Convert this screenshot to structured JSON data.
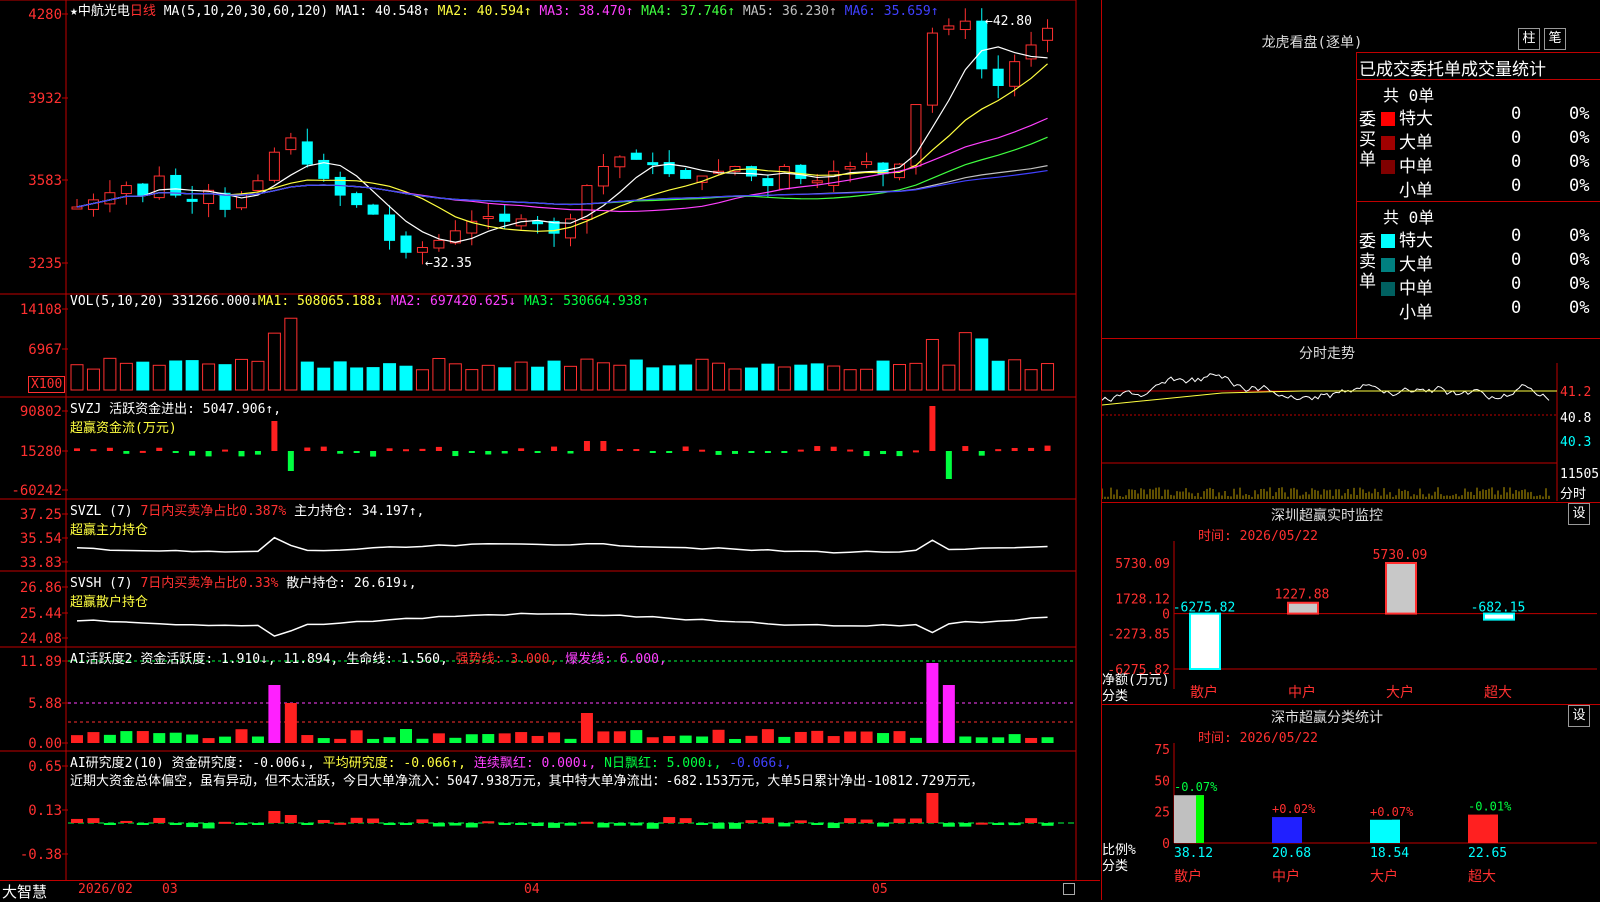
{
  "stock": {
    "name": "中航光电",
    "period": "日线",
    "star": "★"
  },
  "ma": {
    "title": "MA(5,10,20,30,60,120)",
    "items": [
      {
        "label": "MA1: 40.548↑",
        "color": "#ffffff"
      },
      {
        "label": "MA2: 40.594↑",
        "color": "#ffff40"
      },
      {
        "label": "MA3: 38.470↑",
        "color": "#ff40ff"
      },
      {
        "label": "MA4: 37.746↑",
        "color": "#40ff40"
      },
      {
        "label": "MA5: 36.230↑",
        "color": "#c0c0c0"
      },
      {
        "label": "MA6: 35.659↑",
        "color": "#4040ff"
      }
    ]
  },
  "price_axis": [
    "4280",
    "3932",
    "3583",
    "3235"
  ],
  "price_high": "42.80",
  "price_low": "32.35",
  "vol": {
    "title": "VOL(5,10,20)",
    "value": "331266.000↓",
    "ma1": "MA1: 508065.188↓",
    "ma2": "MA2: 697420.625↓",
    "ma3": "MA3: 530664.938↑",
    "axis": [
      "14108",
      "6967"
    ],
    "unit": "X100"
  },
  "svzj": {
    "title": "SVZJ",
    "desc": "活跃资金进出: 5047.906↑,",
    "sub": "超赢资金流(万元)",
    "axis": [
      "90802",
      "15280",
      "-60242"
    ]
  },
  "svzl": {
    "title": "SVZL (7)",
    "desc": "7日内买卖净占比0.387%",
    "hold": "主力持仓: 34.197↑,",
    "sub": "超赢主力持仓",
    "axis": [
      "37.25",
      "35.54",
      "33.83"
    ]
  },
  "svsh": {
    "title": "SVSH (7)",
    "desc": "7日内买卖净占比0.33%",
    "hold": "散户持仓: 26.619↓,",
    "sub": "超赢散户持仓",
    "axis": [
      "26.86",
      "25.44",
      "24.08"
    ]
  },
  "ai1": {
    "title": "AI活跃度2",
    "a": "资金活跃度: 1.910↓, 11.894,",
    "b": "生命线: 1.560,",
    "c": "强势线: 3.000,",
    "d": "爆发线: 6.000,",
    "axis": [
      "11.89",
      "5.88",
      "0.00"
    ]
  },
  "ai2": {
    "title": "AI研究度2(10)",
    "a": "资金研究度: -0.006↓,",
    "b": "平均研究度: -0.066↑,",
    "c": "连续飘红: 0.000↓,",
    "d": "N日飘红: 5.000↓,",
    "e": "-0.066↓,",
    "note": "近期大资金总体偏空，虽有异动，但不太活跃，今日大单净流入：5047.938万元，其中特大单净流出：-682.153万元，大单5日累计净出-10812.729万元，",
    "axis": [
      "0.65",
      "0.13",
      "-0.38"
    ]
  },
  "bottom": {
    "brand": "大智慧",
    "months": [
      "2026/02",
      "03",
      "04",
      "05"
    ]
  },
  "lhkp": {
    "title": "龙虎看盘(逐单)",
    "btn1": "柱",
    "btn2": "笔",
    "header": "已成交委托单成交量统计",
    "buy": {
      "label": "委买单",
      "total": "共 0单",
      "rows": [
        {
          "name": "特大",
          "v": "0",
          "p": "0%",
          "color": "#ff0000"
        },
        {
          "name": "大单",
          "v": "0",
          "p": "0%",
          "color": "#a00000"
        },
        {
          "name": "中单",
          "v": "0",
          "p": "0%",
          "color": "#800000"
        },
        {
          "name": "小单",
          "v": "0",
          "p": "0%",
          "color": "#000000"
        }
      ]
    },
    "sell": {
      "label": "委卖单",
      "total": "共 0单",
      "rows": [
        {
          "name": "特大",
          "v": "0",
          "p": "0%",
          "color": "#00ffff"
        },
        {
          "name": "大单",
          "v": "0",
          "p": "0%",
          "color": "#008080"
        },
        {
          "name": "中单",
          "v": "0",
          "p": "0%",
          "color": "#006060"
        },
        {
          "name": "小单",
          "v": "0",
          "p": "0%",
          "color": "#000000"
        }
      ]
    }
  },
  "fenshi": {
    "title": "分时走势",
    "axis": [
      "41.2",
      "40.8",
      "40.3"
    ],
    "vol": "11505",
    "vol_unit": "分时"
  },
  "monitor": {
    "title": "深圳超赢实时监控",
    "btn": "设",
    "time": "时间: 2026/05/22",
    "axis": [
      "5730.09",
      "1728.12",
      "0",
      "-2273.85",
      "-6275.82"
    ],
    "ylabel": "净额(万元)",
    "xlabel": "分类",
    "bars": [
      {
        "cat": "散户",
        "v": -6275.82,
        "label": "-6275.82"
      },
      {
        "cat": "中户",
        "v": 1227.88,
        "label": "1227.88"
      },
      {
        "cat": "大户",
        "v": 5730.09,
        "label": "5730.09"
      },
      {
        "cat": "超大",
        "v": -682.15,
        "label": "-682.15"
      }
    ]
  },
  "classify": {
    "title": "深市超赢分类统计",
    "btn": "设",
    "time": "时间: 2026/05/22",
    "axis": [
      "75",
      "50",
      "25",
      "0"
    ],
    "ylabel": "比例%",
    "xlabel": "分类",
    "bars": [
      {
        "cat": "散户",
        "v": 38.12,
        "chg": "-0.07%",
        "color": "#c0c0c0",
        "side": "#00ff00"
      },
      {
        "cat": "中户",
        "v": 20.68,
        "chg": "+0.02%",
        "color": "#2020ff",
        "side": "#2020ff"
      },
      {
        "cat": "大户",
        "v": 18.54,
        "chg": "+0.07%",
        "color": "#00ffff",
        "side": "#00ffff"
      },
      {
        "cat": "超大",
        "v": 22.65,
        "chg": "-0.01%",
        "color": "#ff2020",
        "side": "#ff2020"
      }
    ]
  }
}
